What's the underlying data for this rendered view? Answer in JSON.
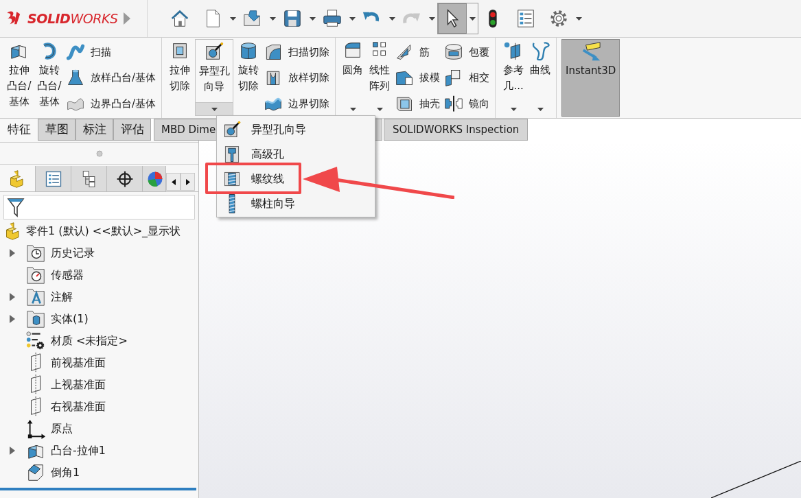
{
  "app": {
    "logo": "**SOLID**WORKS"
  },
  "quick_access": [
    {
      "dropdown": false,
      "disabled": false,
      "selected": false
    },
    {
      "dropdown": true,
      "disabled": false,
      "selected": false
    },
    {
      "dropdown": true,
      "disabled": false,
      "selected": false
    },
    {
      "dropdown": true,
      "disabled": false,
      "selected": false
    },
    {
      "dropdown": true,
      "disabled": false,
      "selected": false
    },
    {
      "dropdown": true,
      "disabled": false,
      "selected": false
    },
    {
      "dropdown": true,
      "disabled": true,
      "selected": false
    },
    {
      "dropdown": true,
      "disabled": false,
      "selected": true
    },
    {
      "dropdown": false,
      "disabled": false,
      "selected": false
    },
    {
      "dropdown": false,
      "disabled": false,
      "selected": false
    },
    {
      "dropdown": true,
      "disabled": false,
      "selected": false
    }
  ],
  "ribbon": [
    {
      "items": [
        {
          "kind": "large",
          "label": "拉伸凸台/基体",
          "dropdown": false,
          "pressed": false
        },
        {
          "kind": "large",
          "label": "旋转凸台/基体",
          "dropdown": false,
          "pressed": false
        },
        {
          "kind": "stack",
          "items": [
            {
              "label": "扫描"
            },
            {
              "label": "放样凸台/基体"
            },
            {
              "label": "边界凸台/基体"
            }
          ]
        }
      ]
    },
    {
      "items": [
        {
          "kind": "large",
          "label": "拉伸切除",
          "dropdown": false,
          "pressed": false
        },
        {
          "kind": "large",
          "label": "异型孔向导",
          "dropdown": true,
          "open": true,
          "pressed": false
        },
        {
          "kind": "large",
          "label": "旋转切除",
          "dropdown": false,
          "pressed": false
        },
        {
          "kind": "stack",
          "items": [
            {
              "label": "扫描切除"
            },
            {
              "label": "放样切除"
            },
            {
              "label": "边界切除"
            }
          ]
        }
      ]
    },
    {
      "items": [
        {
          "kind": "large",
          "label": "圆角",
          "dropdown": true,
          "open": false,
          "pressed": false
        },
        {
          "kind": "large",
          "label": "线性阵列",
          "dropdown": true,
          "open": false,
          "pressed": false
        },
        {
          "kind": "stack",
          "items": [
            {
              "label": "筋"
            },
            {
              "label": "拔模"
            },
            {
              "label": "抽壳"
            }
          ]
        },
        {
          "kind": "stack",
          "items": [
            {
              "label": "包覆"
            },
            {
              "label": "相交"
            },
            {
              "label": "镜向"
            }
          ]
        }
      ]
    },
    {
      "items": [
        {
          "kind": "large",
          "label": "参考几...",
          "dropdown": true,
          "open": false,
          "pressed": false
        },
        {
          "kind": "large",
          "label": "曲线",
          "dropdown": true,
          "open": false,
          "pressed": false
        }
      ]
    },
    {
      "items": [
        {
          "kind": "large",
          "label": "Instant3D",
          "dropdown": false,
          "pressed": true
        }
      ]
    }
  ],
  "tabs": [
    {
      "label": "特征",
      "selected": true
    },
    {
      "label": "草图",
      "selected": false
    },
    {
      "label": "标注",
      "selected": false
    },
    {
      "label": "评估",
      "selected": false
    },
    {
      "label": "MBD Dime",
      "selected": false
    },
    {
      "label": "SOLIDWORKS Inspection",
      "selected": false
    }
  ],
  "dropdown_menu": {
    "items": [
      {
        "label": "异型孔向导",
        "annotated": false
      },
      {
        "label": "高级孔",
        "annotated": false
      },
      {
        "label": "螺纹线",
        "annotated": true
      },
      {
        "label": "螺柱向导",
        "annotated": false
      }
    ]
  },
  "panel_tabs": [
    {
      "selected": true
    },
    {
      "selected": false
    },
    {
      "selected": false
    },
    {
      "selected": false
    },
    {
      "selected": false
    }
  ],
  "tree": {
    "label": "零件1 (默认) <<默认>_显示状",
    "children": [
      {
        "label": "历史记录",
        "expandable": true
      },
      {
        "label": "传感器",
        "expandable": false
      },
      {
        "label": "注解",
        "expandable": true
      },
      {
        "label": "实体(1)",
        "expandable": true
      },
      {
        "label": "材质 <未指定>",
        "expandable": false
      },
      {
        "label": "前视基准面",
        "expandable": false
      },
      {
        "label": "上视基准面",
        "expandable": false
      },
      {
        "label": "右视基准面",
        "expandable": false
      },
      {
        "label": "原点",
        "expandable": false
      },
      {
        "label": "凸台-拉伸1",
        "expandable": true
      },
      {
        "label": "倒角1",
        "expandable": false
      }
    ]
  }
}
